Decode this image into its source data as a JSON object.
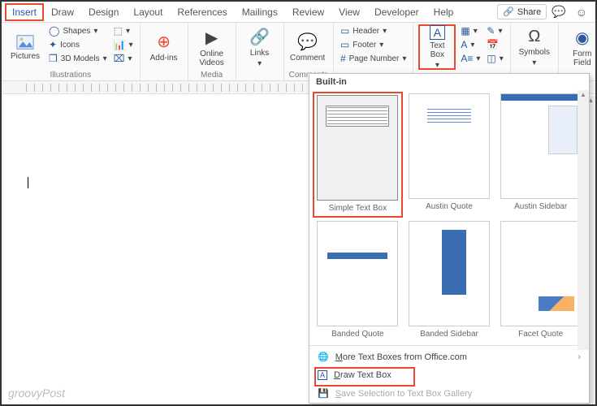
{
  "tabs": {
    "items": [
      "Insert",
      "Draw",
      "Design",
      "Layout",
      "References",
      "Mailings",
      "Review",
      "View",
      "Developer",
      "Help"
    ],
    "active": 0,
    "share": "Share"
  },
  "ribbon": {
    "illustrations": {
      "label": "Illustrations",
      "pictures": "Pictures",
      "shapes": "Shapes",
      "icons": "Icons",
      "models": "3D Models"
    },
    "addins": {
      "label": "Add-ins"
    },
    "media": {
      "label": "Media",
      "video": "Online\nVideos"
    },
    "links": {
      "label": "Links"
    },
    "comments": {
      "label": "Comments",
      "comment": "Comment"
    },
    "headerfooter": {
      "header": "Header",
      "footer": "Footer",
      "pagenum": "Page Number"
    },
    "text": {
      "textbox": "Text\nBox"
    },
    "symbols": {
      "label": "Symbols"
    },
    "form": {
      "label": "Form\nField"
    }
  },
  "dropdown": {
    "section": "Built-in",
    "items": [
      {
        "label": "Simple Text Box",
        "kind": "simple",
        "highlighted": true
      },
      {
        "label": "Austin Quote",
        "kind": "quote"
      },
      {
        "label": "Austin Sidebar",
        "kind": "sidebar-light"
      },
      {
        "label": "Banded Quote",
        "kind": "band"
      },
      {
        "label": "Banded Sidebar",
        "kind": "band-side"
      },
      {
        "label": "Facet Quote",
        "kind": "facet"
      }
    ],
    "more": "More Text Boxes from Office.com",
    "draw": "Draw Text Box",
    "save": "Save Selection to Text Box Gallery"
  },
  "watermark": "groovyPost"
}
